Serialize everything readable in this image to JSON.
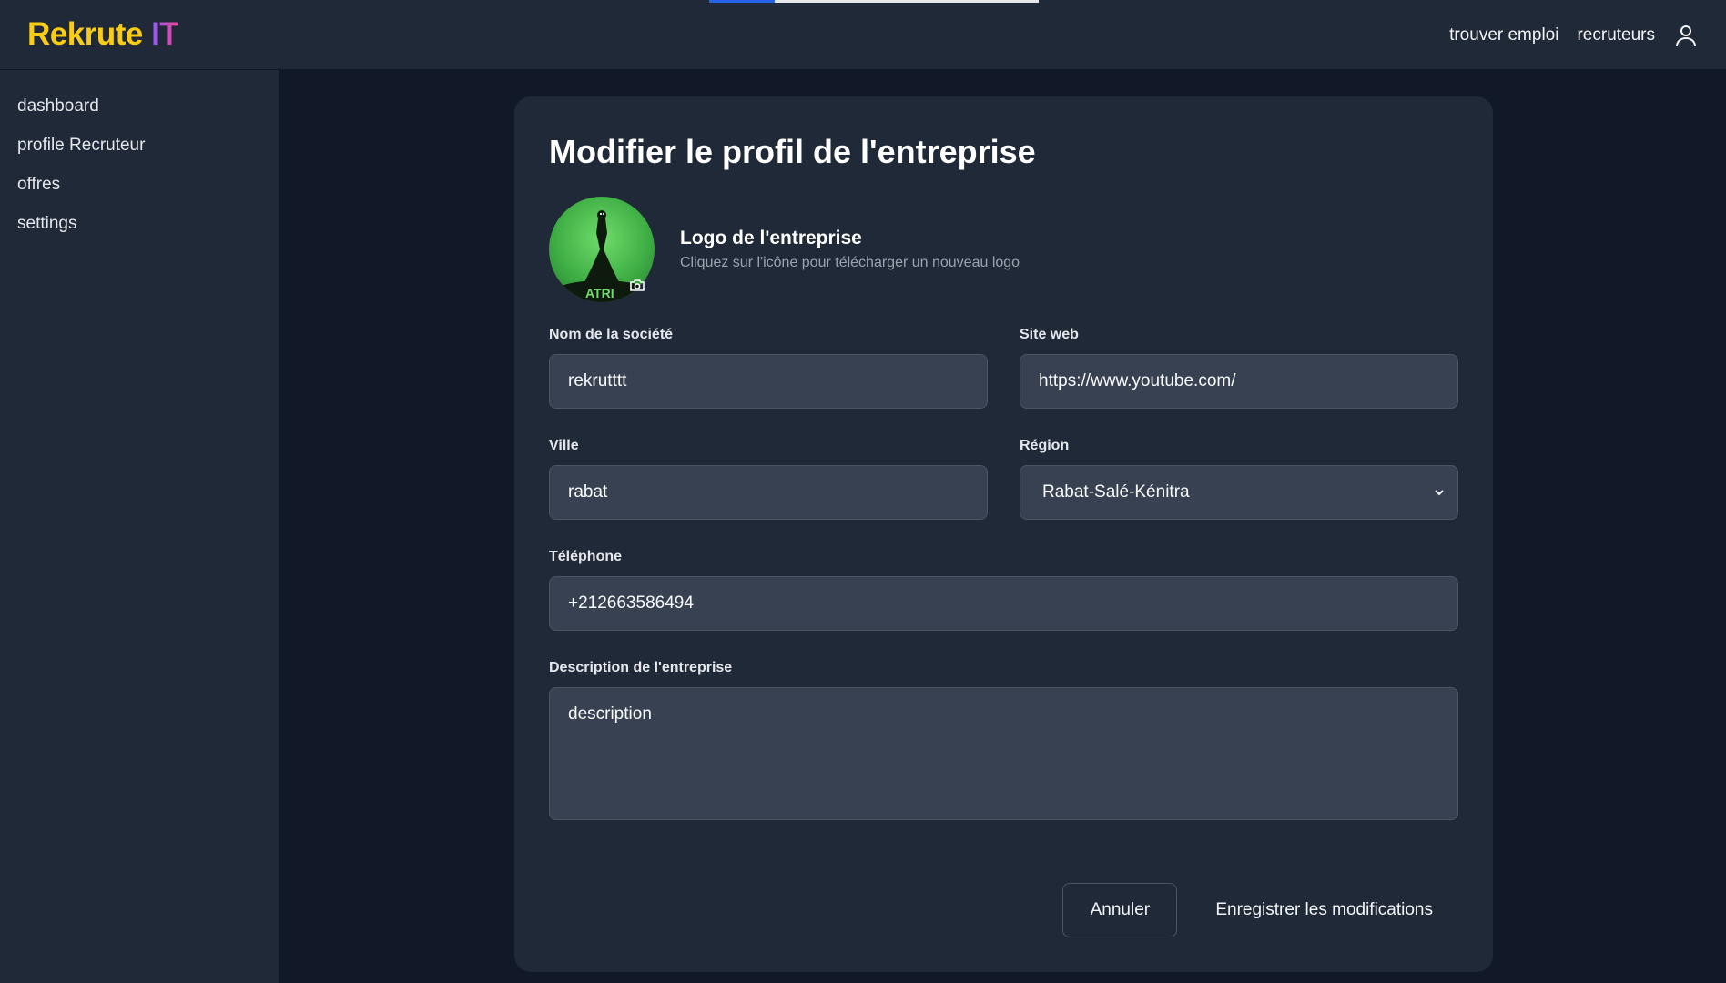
{
  "brand": {
    "part1": "Rekrute",
    "part2": "IT"
  },
  "nav": {
    "find_job": "trouver emploi",
    "recruiters": "recruteurs",
    "user_icon": "user-icon"
  },
  "sidebar": {
    "items": [
      {
        "label": "dashboard"
      },
      {
        "label": "profile Recruteur"
      },
      {
        "label": "offres"
      },
      {
        "label": "settings"
      }
    ]
  },
  "page": {
    "title": "Modifier le profil de l'entreprise"
  },
  "logo": {
    "heading": "Logo de l'entreprise",
    "subtitle": "Cliquez sur l'icône pour télécharger un nouveau logo",
    "camera_icon": "camera-icon"
  },
  "form": {
    "company_name": {
      "label": "Nom de la société",
      "value": "rekrutttt"
    },
    "website": {
      "label": "Site web",
      "value": "https://www.youtube.com/"
    },
    "city": {
      "label": "Ville",
      "value": "rabat"
    },
    "region": {
      "label": "Région",
      "value": "Rabat-Salé-Kénitra"
    },
    "phone": {
      "label": "Téléphone",
      "value": "+212663586494"
    },
    "description": {
      "label": "Description de l'entreprise",
      "value": "description"
    }
  },
  "actions": {
    "cancel": "Annuler",
    "save": "Enregistrer les modifications"
  },
  "colors": {
    "background": "#111827",
    "surface": "#1f2937",
    "input": "#374151",
    "brand_yellow": "#facc15",
    "brand_gradient_start": "#8b5cf6",
    "brand_gradient_end": "#ec4899",
    "progress": "#2563eb"
  },
  "progress": {
    "fraction": 0.2
  }
}
